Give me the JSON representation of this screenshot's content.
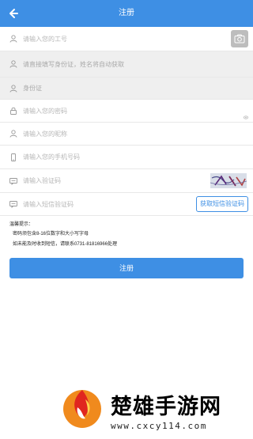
{
  "header": {
    "title": "注册"
  },
  "form": {
    "work_id": {
      "placeholder": "请输入您的工号"
    },
    "name": {
      "placeholder": "请直接填写身份证，姓名将自动获取"
    },
    "id_card": {
      "placeholder": "身份证"
    },
    "password": {
      "placeholder": "请输入您的密码"
    },
    "nickname": {
      "placeholder": "请输入您的昵称"
    },
    "phone": {
      "placeholder": "请输入您的手机号码"
    },
    "captcha": {
      "placeholder": "请输入验证码"
    },
    "sms": {
      "placeholder": "请输入短信验证码",
      "button_label": "获取短信验证码"
    }
  },
  "tips": {
    "title": "温馨提示：",
    "line1": "密码须包含8-16位数字和大小写字母",
    "line2": "如未能及时收到短信，请联系0731-81816966处理"
  },
  "submit": {
    "label": "注册"
  },
  "watermark": {
    "name": "楚雄手游网",
    "url": "www.cxcy114.com"
  },
  "colors": {
    "primary": "#3e8fe4",
    "input_bg_gray": "#efefef"
  },
  "icons": {
    "back": "arrow-left-icon",
    "user": "user-icon",
    "lock": "lock-icon",
    "phone": "phone-icon",
    "captcha": "message-icon",
    "camera": "camera-icon",
    "eye": "eye-icon"
  }
}
